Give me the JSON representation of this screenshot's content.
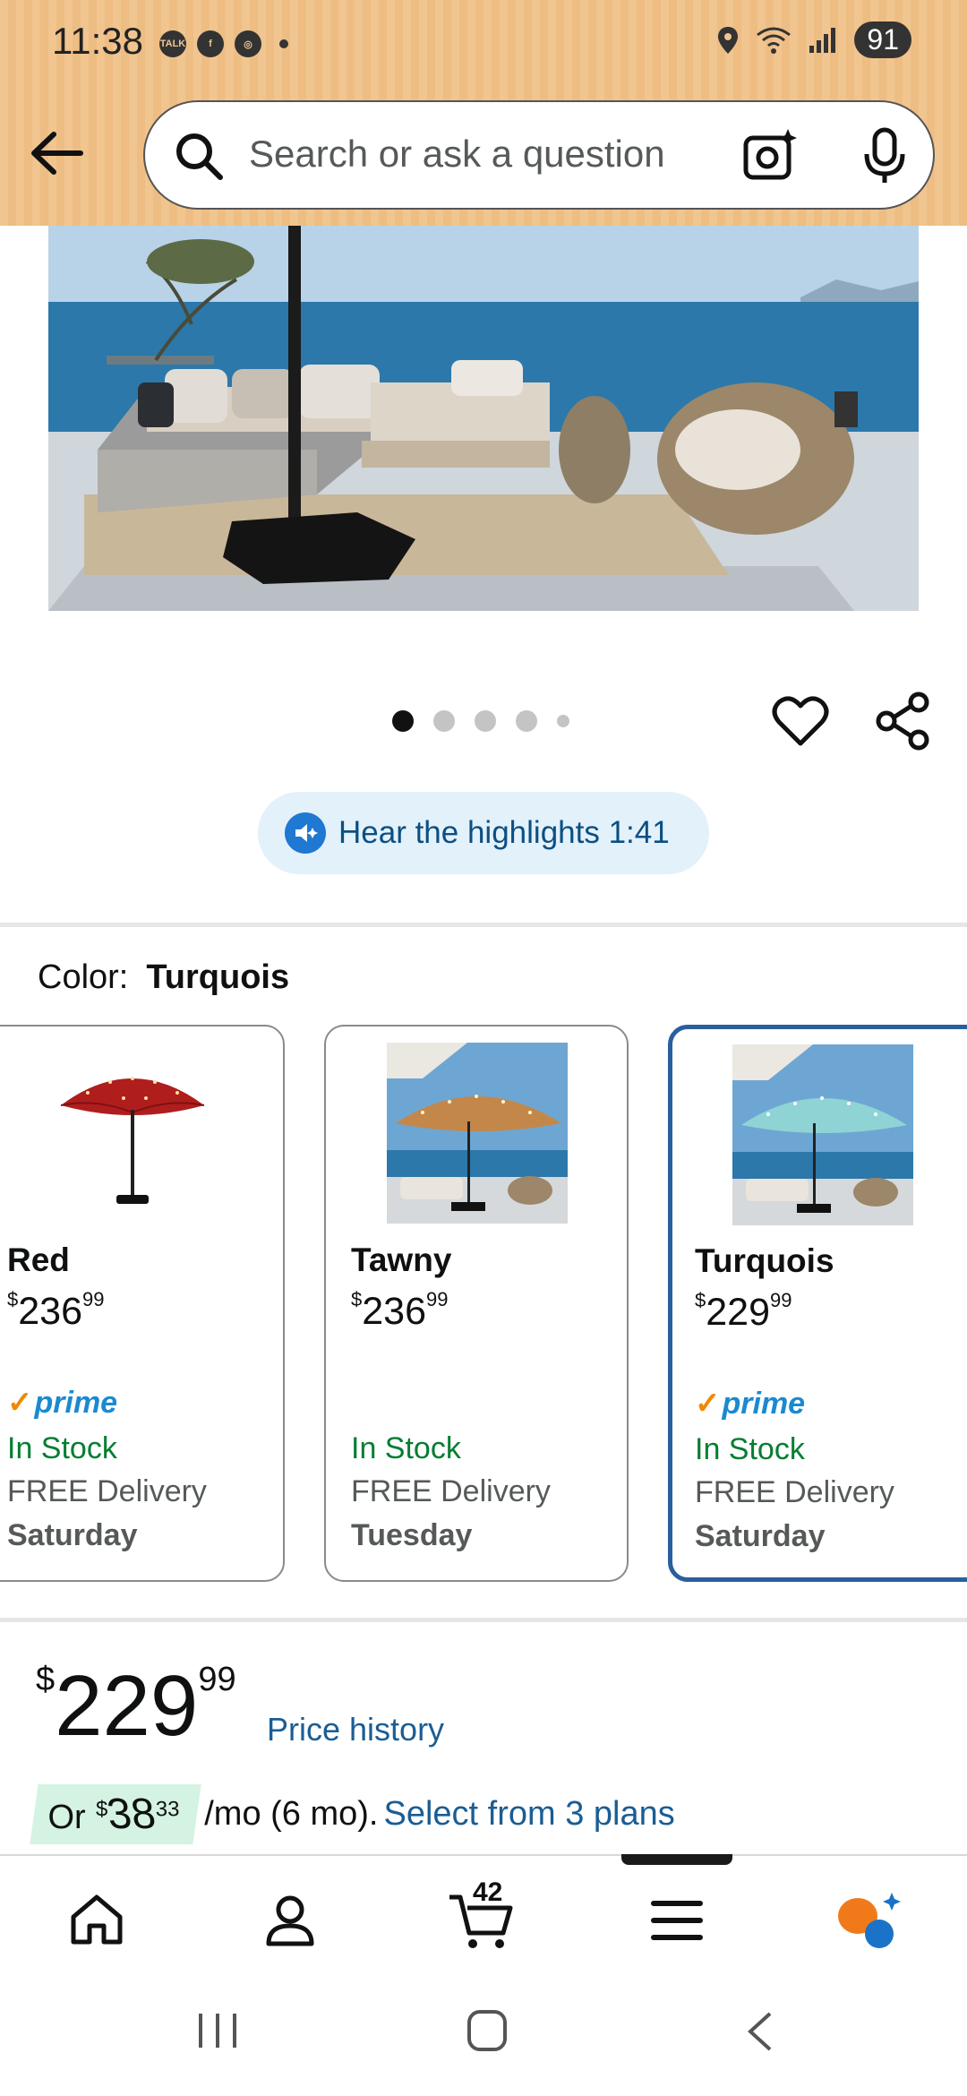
{
  "status_bar": {
    "time": "11:38",
    "battery": "91"
  },
  "search": {
    "placeholder": "Search or ask a question"
  },
  "gallery": {
    "total_images": 5,
    "active_index": 0
  },
  "audio": {
    "label": "Hear the highlights 1:41"
  },
  "color": {
    "label": "Color:",
    "selected": "Turquois"
  },
  "variants": [
    {
      "name": "Red",
      "currency": "$",
      "price_whole": "236",
      "price_cents": "99",
      "prime": "prime",
      "stock": "In Stock",
      "delivery": "FREE Delivery",
      "day": "Saturday"
    },
    {
      "name": "Tawny",
      "currency": "$",
      "price_whole": "236",
      "price_cents": "99",
      "prime": "",
      "stock": "In Stock",
      "delivery": "FREE Delivery",
      "day": "Tuesday"
    },
    {
      "name": "Turquois",
      "currency": "$",
      "price_whole": "229",
      "price_cents": "99",
      "prime": "prime",
      "stock": "In Stock",
      "delivery": "FREE Delivery",
      "day": "Saturday"
    }
  ],
  "price": {
    "currency": "$",
    "whole": "229",
    "cents": "99",
    "history_link": "Price history"
  },
  "installment": {
    "prefix": "Or",
    "currency": "$",
    "whole": "38",
    "cents": "33",
    "suffix": "/mo (6 mo).",
    "link": "Select from 3 plans"
  },
  "nav": {
    "cart_count": "42",
    "items": [
      "home-icon",
      "account-icon",
      "cart-icon",
      "menu-icon",
      "rufus-icon"
    ]
  },
  "colors": {
    "accent_link": "#1a5d94",
    "in_stock": "#067d32",
    "selected_border": "#2a5f9e",
    "header_bg": "#f1c58f"
  }
}
